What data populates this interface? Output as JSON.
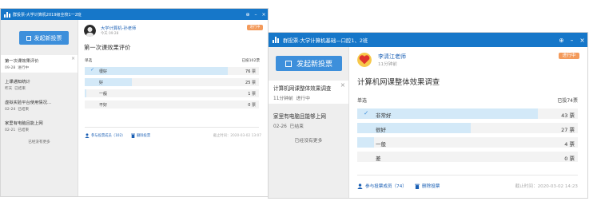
{
  "window_a": {
    "title": "群投票-大学计算机2019级全校1一2班",
    "new_vote_label": "发起新投票",
    "sidebar_items": [
      {
        "title": "第一次课效果评价",
        "date": "09-28",
        "status": "进行中",
        "active": true
      },
      {
        "title": "上课通知统计",
        "date": "昨天",
        "status": "已结束",
        "active": false
      },
      {
        "title": "虚拟实验平台使用情况...",
        "date": "02-24",
        "status": "已结束",
        "active": false
      },
      {
        "title": "家里有电脑且能上网",
        "date": "02-21",
        "status": "已结束",
        "active": false
      }
    ],
    "no_more": "已经没有更多",
    "poll": {
      "author": "大学计算机-孙老师",
      "time": "今天 09:28",
      "badge": "进行中",
      "title": "第一次课效果评价",
      "type_label": "单选",
      "voted_count": "已投102票",
      "options": [
        {
          "label": "很好",
          "count": "76 票",
          "votes": 76,
          "selected": true
        },
        {
          "label": "好",
          "count": "25 票",
          "votes": 25,
          "selected": false
        },
        {
          "label": "一般",
          "count": "1 票",
          "votes": 1,
          "selected": false
        },
        {
          "label": "不好",
          "count": "0 票",
          "votes": 0,
          "selected": false
        }
      ],
      "participants": "参与投票成员（102）",
      "delete": "删除投票",
      "deadline": "截止时间：2020-03-02 13:07"
    }
  },
  "window_b": {
    "title": "群投票-大学计算机基础—口腔1、2班",
    "new_vote_label": "发起新投票",
    "sidebar_items": [
      {
        "title": "计算机网课整体效果调查",
        "date": "11分钟前",
        "status": "进行中",
        "active": true
      },
      {
        "title": "家里有电脑且能够上网",
        "date": "02-26",
        "status": "已结束",
        "active": false
      }
    ],
    "no_more": "已经没有更多",
    "poll": {
      "author": "李清江老师",
      "time": "11分钟前",
      "badge": "进行中",
      "title": "计算机网课整体效果调查",
      "type_label": "单选",
      "voted_count": "已投74票",
      "options": [
        {
          "label": "非常好",
          "count": "43 票",
          "votes": 43,
          "selected": true
        },
        {
          "label": "很好",
          "count": "27 票",
          "votes": 27,
          "selected": false
        },
        {
          "label": "一般",
          "count": "4 票",
          "votes": 4,
          "selected": false
        },
        {
          "label": "差",
          "count": "0 票",
          "votes": 0,
          "selected": false
        }
      ],
      "participants": "参与投票成员（74）",
      "delete": "删除投票",
      "deadline": "截止时间：2020-03-02 14:23"
    }
  },
  "controls": {
    "pin": "⊕",
    "minimize": "–",
    "close": "×"
  },
  "colors": {
    "titlebar": "#1677c9",
    "accent": "#3d8fdb",
    "badge": "#f39a5b",
    "bar_fill": "#d3e9f8",
    "sidebar": "#eeeeee"
  }
}
